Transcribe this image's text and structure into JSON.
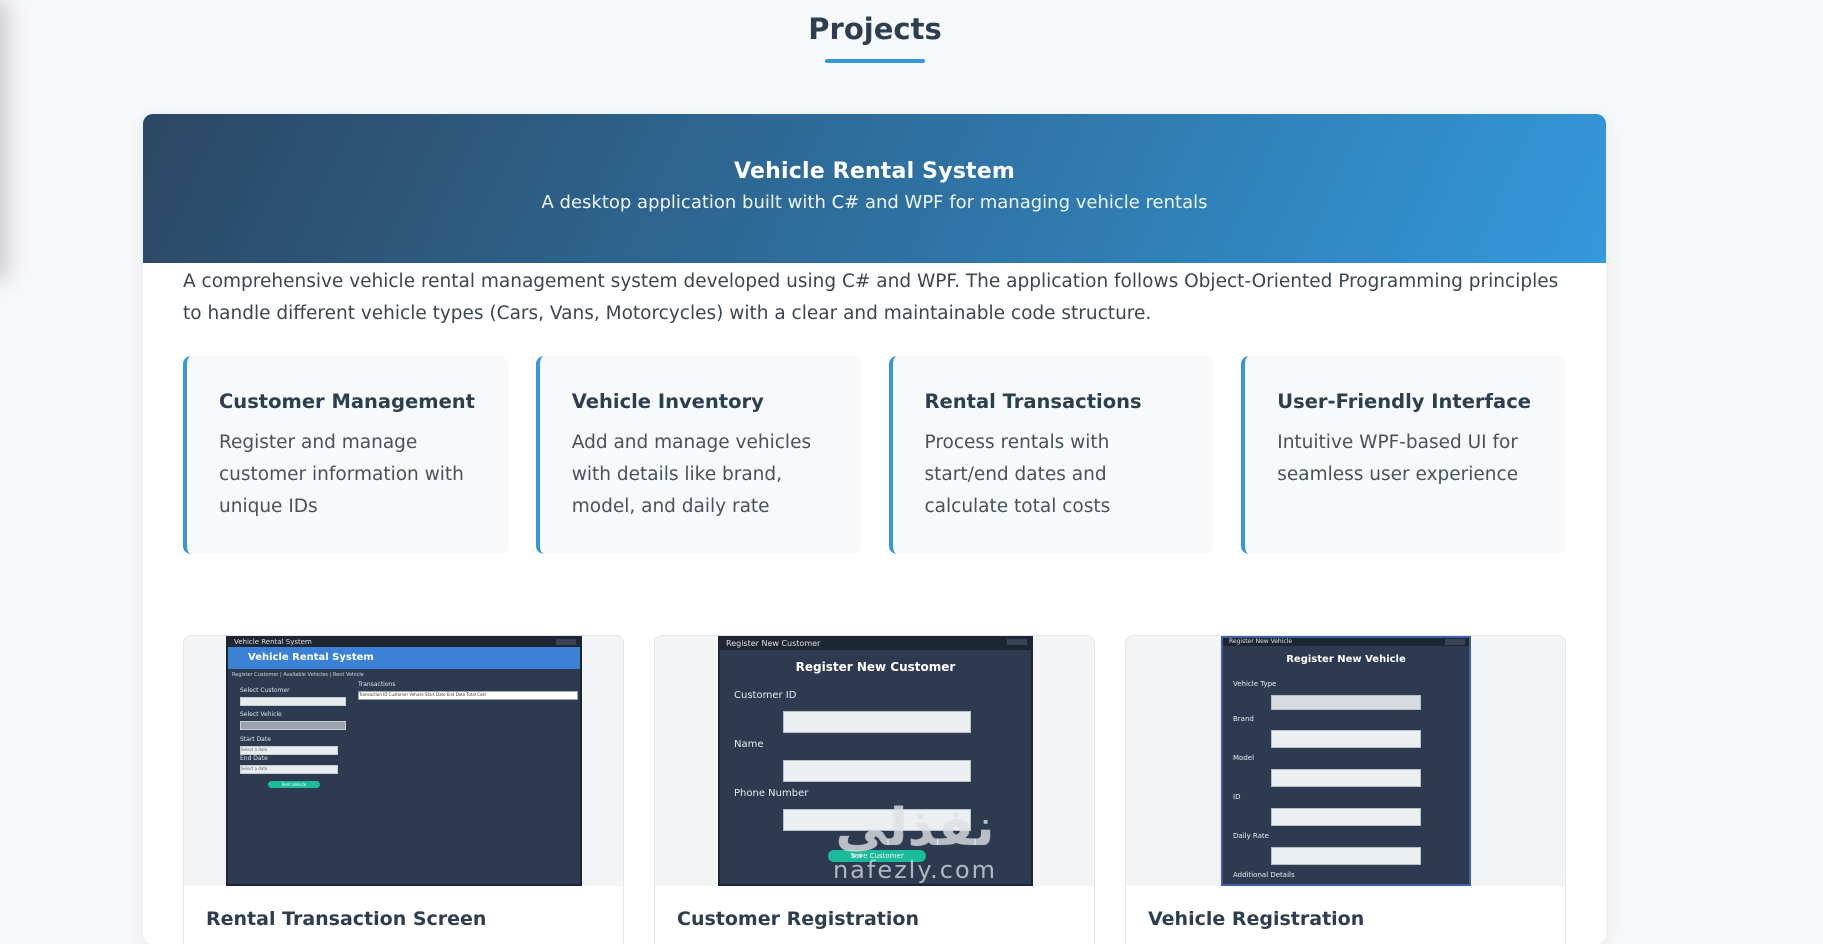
{
  "section": {
    "title": "Projects"
  },
  "project": {
    "title": "Vehicle Rental System",
    "subtitle": "A desktop application built with C# and WPF for managing vehicle rentals",
    "description": "A comprehensive vehicle rental management system developed using C# and WPF. The application follows Object-Oriented Programming principles to handle different vehicle types (Cars, Vans, Motorcycles) with a clear and maintainable code structure.",
    "features": [
      {
        "title": "Customer Management",
        "text": "Register and manage customer information with unique IDs"
      },
      {
        "title": "Vehicle Inventory",
        "text": "Add and manage vehicles with details like brand, model, and daily rate"
      },
      {
        "title": "Rental Transactions",
        "text": "Process rentals with start/end dates and calculate total costs"
      },
      {
        "title": "User-Friendly Interface",
        "text": "Intuitive WPF-based UI for seamless user experience"
      }
    ],
    "screenshots": [
      {
        "caption": "Rental Transaction Screen",
        "window_title": "Vehicle Rental System",
        "banner": "Vehicle Rental System",
        "tabs": "Register Customer | Available Vehicles | Rent Vehicle",
        "labels": [
          "Select Customer",
          "Select Vehicle",
          "Start Date",
          "End Date",
          "Transactions"
        ],
        "grid_header": "Transaction ID   Customer   Vehicle   Start Date   End Date   Total Cost",
        "date_placeholder": "Select a date",
        "button": "Rent Vehicle"
      },
      {
        "caption": "Customer Registration",
        "window_title": "Register New Customer",
        "heading": "Register New Customer",
        "labels": [
          "Customer ID",
          "Name",
          "Phone Number"
        ],
        "button": "Save Customer"
      },
      {
        "caption": "Vehicle Registration",
        "window_title": "Register New Vehicle",
        "heading": "Register New Vehicle",
        "labels": [
          "Vehicle Type",
          "Brand",
          "Model",
          "ID",
          "Daily Rate",
          "Additional Details"
        ]
      }
    ]
  },
  "watermark": {
    "arabic": "نفذلي",
    "latin": "nafezly.com"
  },
  "colors": {
    "accent": "#3498db",
    "heading": "#2c3e50",
    "header_dark": "#2c4763",
    "app_bg": "#2e3a50",
    "button": "#1abc9c"
  }
}
